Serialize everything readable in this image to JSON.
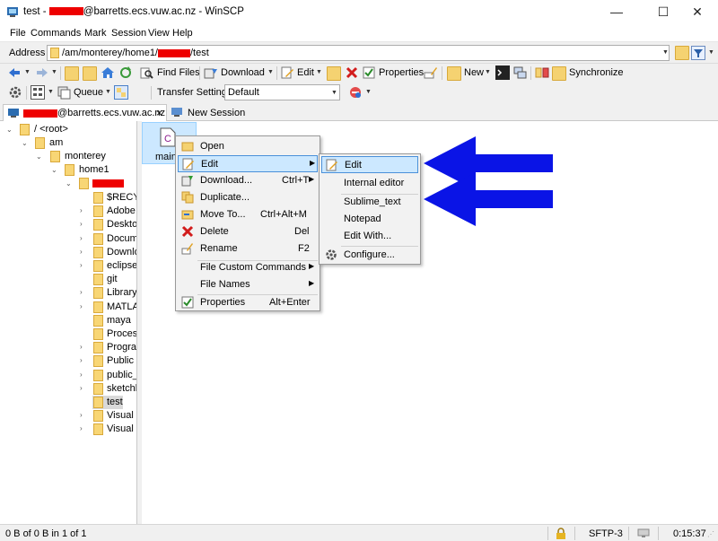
{
  "window": {
    "title_prefix": "test - ",
    "title_suffix": "@barretts.ecs.vuw.ac.nz - WinSCP",
    "minimize": "—",
    "maximize": "☐",
    "close": "✕"
  },
  "menubar": [
    "File",
    "Commands",
    "Mark",
    "Session",
    "View",
    "Help"
  ],
  "address": {
    "label": "Address",
    "path_prefix": "/am/monterey/home1/",
    "path_suffix": "/test"
  },
  "toolbar1": {
    "find_files": "Find Files",
    "download": "Download",
    "edit": "Edit",
    "properties": "Properties",
    "new": "New",
    "synchronize": "Synchronize"
  },
  "toolbar2": {
    "queue": "Queue",
    "transfer_settings_label": "Transfer Settings",
    "transfer_settings_value": "Default"
  },
  "tabs": {
    "session_suffix": "@barretts.ecs.vuw.ac.nz",
    "close": "×",
    "new_session": "New Session"
  },
  "tree": {
    "root": "/ <root>",
    "am": "am",
    "monterey": "monterey",
    "home1": "home1",
    "children": [
      "$RECYC",
      "Adobe",
      "Desktop",
      "Docum",
      "Downlo",
      "eclipse-",
      "git",
      "Library",
      "MATLAB",
      "maya",
      "Process",
      "Program",
      "Public",
      "public_",
      "sketchb",
      "test",
      "Visual S",
      "Visual S"
    ]
  },
  "file": {
    "name": "main",
    "icon_letter": "C"
  },
  "context_menu": [
    {
      "label": "Open",
      "shortcut": ""
    },
    {
      "label": "Edit",
      "shortcut": ""
    },
    {
      "label": "Download...",
      "shortcut": "Ctrl+T"
    },
    {
      "label": "Duplicate...",
      "shortcut": ""
    },
    {
      "label": "Move To...",
      "shortcut": "Ctrl+Alt+M"
    },
    {
      "label": "Delete",
      "shortcut": "Del"
    },
    {
      "label": "Rename",
      "shortcut": "F2"
    },
    {
      "label": "File Custom Commands",
      "shortcut": ""
    },
    {
      "label": "File Names",
      "shortcut": ""
    },
    {
      "label": "Properties",
      "shortcut": "Alt+Enter"
    }
  ],
  "submenu": [
    "Edit",
    "Internal editor",
    "Sublime_text",
    "Notepad",
    "Edit With...",
    "Configure..."
  ],
  "status": {
    "left": "0 B of 0 B in 1 of 1",
    "protocol": "SFTP-3",
    "time": "0:15:37"
  },
  "colors": {
    "arrow": "#0a14e6",
    "highlight": "#cce8ff",
    "redaction": "#ee0000"
  }
}
